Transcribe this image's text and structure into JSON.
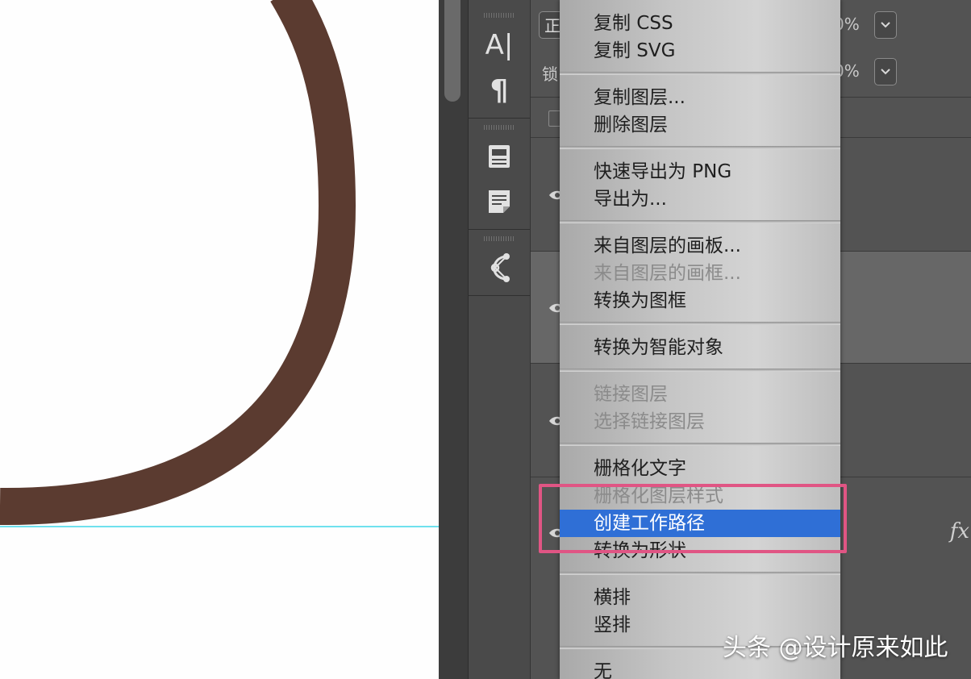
{
  "canvas": {
    "stroke_color": "#5b3b30",
    "guide_color": "#6fe1ee"
  },
  "tools": {
    "type_tool_glyph": "A|",
    "paragraph_glyph": "¶"
  },
  "layers_panel": {
    "blend_mode_fragment": "正",
    "opacity_fragment": "0%",
    "fill_fragment": "0%",
    "lock_label_fragment": "锁",
    "fx_label": "fx"
  },
  "context_menu": {
    "items": [
      {
        "label": "复制 CSS",
        "disabled": false
      },
      {
        "label": "复制 SVG",
        "disabled": false
      },
      {
        "label": "复制图层...",
        "disabled": false
      },
      {
        "label": "删除图层",
        "disabled": false
      },
      {
        "label": "快速导出为 PNG",
        "disabled": false
      },
      {
        "label": "导出为...",
        "disabled": false
      },
      {
        "label": "来自图层的画板...",
        "disabled": false
      },
      {
        "label": "来自图层的画框...",
        "disabled": true
      },
      {
        "label": "转换为图框",
        "disabled": false
      },
      {
        "label": "转换为智能对象",
        "disabled": false
      },
      {
        "label": "链接图层",
        "disabled": true
      },
      {
        "label": "选择链接图层",
        "disabled": true
      },
      {
        "label": "栅格化文字",
        "disabled": false
      },
      {
        "label": "栅格化图层样式",
        "disabled": true
      },
      {
        "label": "创建工作路径",
        "disabled": false,
        "highlighted": true
      },
      {
        "label": "转换为形状",
        "disabled": false
      },
      {
        "label": "横排",
        "disabled": false
      },
      {
        "label": "竖排",
        "disabled": false
      },
      {
        "label": "无",
        "disabled": false
      }
    ],
    "highlight_color": "#2f6fd6",
    "annotation_color": "#e05584"
  },
  "watermark": "头条 @设计原来如此"
}
